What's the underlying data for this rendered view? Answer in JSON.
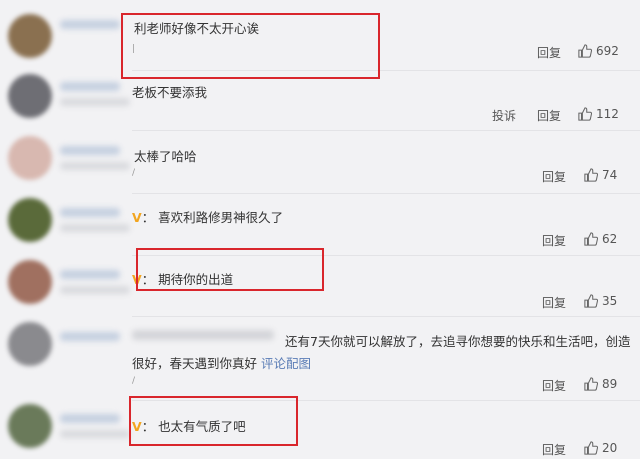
{
  "comments": [
    {
      "text": "利老师好像不太开心诶",
      "reply": "回复",
      "likes": "692",
      "avatar_color": "#8a7050"
    },
    {
      "text": "老板不要添我",
      "report": "投诉",
      "reply": "回复",
      "likes": "112",
      "avatar_color": "#6e6e74"
    },
    {
      "text": "太棒了哈哈",
      "reply": "回复",
      "likes": "74",
      "avatar_color": "#d8b8b0"
    },
    {
      "badge": "V",
      "text": "：  喜欢利路修男神很久了",
      "reply": "回复",
      "likes": "62",
      "avatar_color": "#5a6a3a"
    },
    {
      "badge": "V",
      "text": "：  期待你的出道",
      "reply": "回复",
      "likes": "35",
      "avatar_color": "#a07060"
    },
    {
      "text_line1": "还有7天你就可以解放了，去追寻你想要的快乐和生活吧，创造",
      "text_line2": "很好，春天遇到你真好 ",
      "link": "评论配图",
      "reply": "回复",
      "likes": "89",
      "avatar_color": "#8a8a8e"
    },
    {
      "badge": "V",
      "text": "：  也太有气质了吧",
      "reply": "回复",
      "likes": "20",
      "avatar_color": "#6a7a5a"
    }
  ],
  "colors": {
    "highlight": "#d9262c",
    "link": "#5b7db6",
    "badge": "#f2a51f"
  },
  "icons": {
    "like": "thumbs-up-icon"
  }
}
